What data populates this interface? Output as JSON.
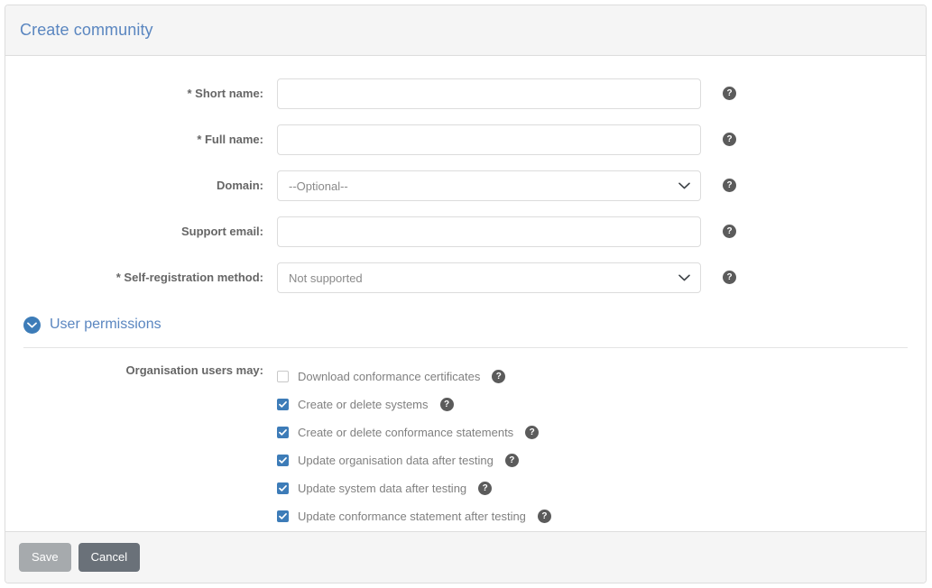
{
  "panel": {
    "title": "Create community"
  },
  "form": {
    "fields": [
      {
        "label": "* Short name:",
        "type": "text",
        "value": "",
        "placeholder": ""
      },
      {
        "label": "* Full name:",
        "type": "text",
        "value": "",
        "placeholder": ""
      },
      {
        "label": "Domain:",
        "type": "select",
        "value": "--Optional--"
      },
      {
        "label": "Support email:",
        "type": "text",
        "value": "",
        "placeholder": ""
      },
      {
        "label": "* Self-registration method:",
        "type": "select",
        "value": "Not supported"
      }
    ],
    "help_icon": "?"
  },
  "section": {
    "title": "User permissions",
    "toggle_icon": "chevron-down-icon"
  },
  "permissions": {
    "label": "Organisation users may:",
    "items": [
      {
        "label": "Download conformance certificates",
        "checked": false
      },
      {
        "label": "Create or delete systems",
        "checked": true
      },
      {
        "label": "Create or delete conformance statements",
        "checked": true
      },
      {
        "label": "Update organisation data after testing",
        "checked": true
      },
      {
        "label": "Update system data after testing",
        "checked": true
      },
      {
        "label": "Update conformance statement after testing",
        "checked": true
      }
    ]
  },
  "footer": {
    "save_label": "Save",
    "cancel_label": "Cancel"
  },
  "colors": {
    "accent_blue": "#3d7cb8",
    "title_blue": "#5a86c0",
    "help_grey": "#5b5b5b",
    "save_grey": "#a6aaad",
    "cancel_grey": "#6a7179"
  }
}
